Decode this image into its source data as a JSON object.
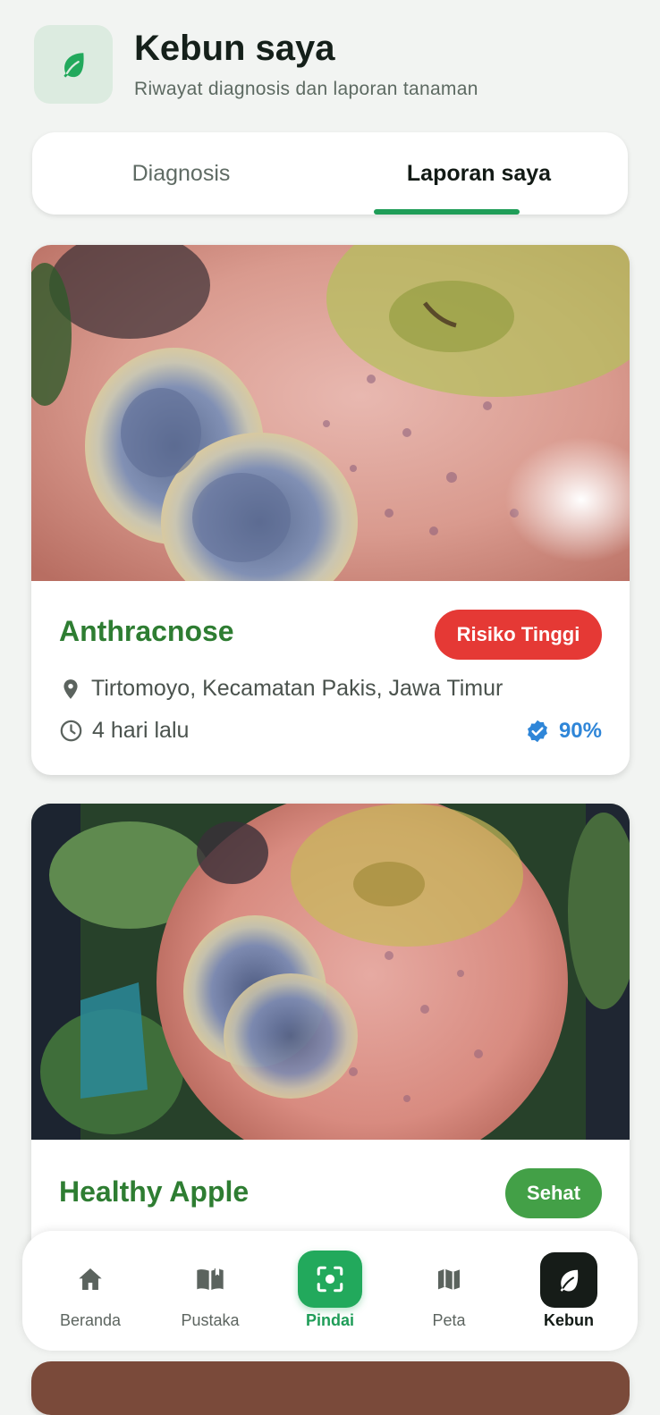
{
  "header": {
    "title": "Kebun saya",
    "subtitle": "Riwayat diagnosis dan laporan tanaman",
    "icon": "leaf-icon"
  },
  "tabs": [
    {
      "label": "Diagnosis",
      "active": false
    },
    {
      "label": "Laporan saya",
      "active": true
    }
  ],
  "reports": [
    {
      "title": "Anthracnose",
      "badge": "Risiko Tinggi",
      "badge_color": "#e53935",
      "location": "Tirtomoyo, Kecamatan Pakis, Jawa Timur",
      "time": "4 hari lalu",
      "confidence": "90%"
    },
    {
      "title": "Healthy Apple",
      "badge": "Sehat",
      "badge_color": "#43a047"
    }
  ],
  "nav": [
    {
      "label": "Beranda",
      "icon": "home-icon"
    },
    {
      "label": "Pustaka",
      "icon": "book-icon"
    },
    {
      "label": "Pindai",
      "icon": "scan-icon"
    },
    {
      "label": "Peta",
      "icon": "map-icon"
    },
    {
      "label": "Kebun",
      "icon": "leaf-icon",
      "active": true
    }
  ],
  "colors": {
    "accent": "#1f9d58",
    "title_green": "#2e7d32",
    "risk_red": "#e53935",
    "verified_blue": "#2f86d8"
  }
}
